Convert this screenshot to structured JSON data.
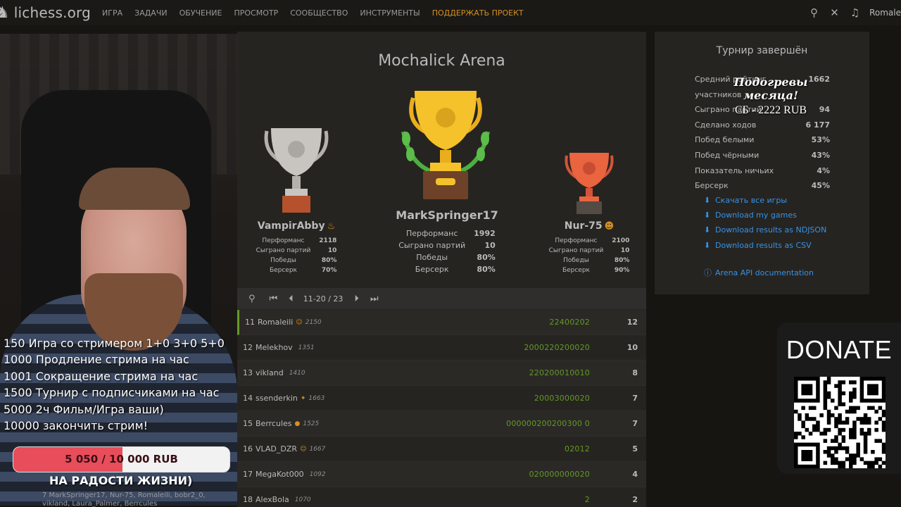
{
  "nav": {
    "brand": "lichess.org",
    "items": [
      "ИГРА",
      "ЗАДАЧИ",
      "ОБУЧЕНИЕ",
      "ПРОСМОТР",
      "СООБЩЕСТВО",
      "ИНСТРУМЕНТЫ"
    ],
    "donate": "ПОДДЕРЖАТЬ ПРОЕКТ",
    "user": "Romale"
  },
  "stream": {
    "commands": [
      "150 Игра со стримером 1+0 3+0 5+0",
      "1000 Продление стрима на час",
      "1001  Сокращение стрима на час",
      "1500 Турнир с подписчиками на час",
      "5000 2ч Фильм/Игра ваши)",
      "10000 закончить стрим!"
    ],
    "progress_text": "5 050 / 10 000 RUB",
    "progress_fraction": 0.505,
    "goal_name": "НА РАДОСТИ ЖИЗНИ)",
    "players_line": "7 MarkSpringer17, Nur-75, Romaleili, bobr2_0, vikland, Laura_Palmer, Berrcules"
  },
  "arena": {
    "title": "Mochalick Arena",
    "podium": {
      "first": {
        "name": "MarkSpringer17",
        "stats": [
          [
            "Перформанс",
            "1992"
          ],
          [
            "Сыграно партий",
            "10"
          ],
          [
            "Победы",
            "80%"
          ],
          [
            "Берсерк",
            "80%"
          ]
        ]
      },
      "second": {
        "name": "VampirAbby",
        "stats": [
          [
            "Перформанс",
            "2118"
          ],
          [
            "Сыграно партий",
            "10"
          ],
          [
            "Победы",
            "80%"
          ],
          [
            "Берсерк",
            "70%"
          ]
        ]
      },
      "third": {
        "name": "Nur-75",
        "stats": [
          [
            "Перформанс",
            "2100"
          ],
          [
            "Сыграно партий",
            "10"
          ],
          [
            "Победы",
            "80%"
          ],
          [
            "Берсерк",
            "90%"
          ]
        ]
      }
    },
    "pagination": "11-20 / 23",
    "standings": [
      {
        "rank": "11",
        "name": "Romaleili",
        "flair": "☺",
        "rating": "2150",
        "scores": "22400202",
        "total": "12"
      },
      {
        "rank": "12",
        "name": "Melekhov",
        "flair": "",
        "rating": "1351",
        "scores": "2000220200020",
        "total": "10"
      },
      {
        "rank": "13",
        "name": "vikland",
        "flair": "",
        "rating": "1410",
        "scores": "220200010010",
        "total": "8"
      },
      {
        "rank": "14",
        "name": "ssenderkin",
        "flair": "✦",
        "rating": "1663",
        "scores": "20003000020",
        "total": "7"
      },
      {
        "rank": "15",
        "name": "Berrcules",
        "flair": "●",
        "rating": "1525",
        "scores": "000000200200300 0",
        "total": "7"
      },
      {
        "rank": "16",
        "name": "VLAD_DZR",
        "flair": "☺",
        "rating": "1667",
        "scores": "02012",
        "total": "5"
      },
      {
        "rank": "17",
        "name": "MegaKot000",
        "flair": "",
        "rating": "1092",
        "scores": "020000000020",
        "total": "4"
      },
      {
        "rank": "18",
        "name": "AlexBola",
        "flair": "",
        "rating": "1070",
        "scores": "2",
        "total": "2"
      }
    ]
  },
  "stats": {
    "title": "Турнир завершён",
    "lines": [
      [
        "Средний рейтинг участников",
        "1662"
      ],
      [
        "Сыграно партий",
        "94"
      ],
      [
        "Сделано ходов",
        "6 177"
      ],
      [
        "Побед белыми",
        "53%"
      ],
      [
        "Побед чёрными",
        "43%"
      ],
      [
        "Показатель ничьих",
        "4%"
      ],
      [
        "Берсерк",
        "45%"
      ]
    ],
    "links": [
      "Скачать все игры",
      "Download my games",
      "Download results as NDJSON",
      "Download results as CSV"
    ],
    "api": "Arena API documentation"
  },
  "promo": {
    "line1": "Подогревы месяца!",
    "line2": "СБ - 2222 RUB"
  },
  "donate": {
    "label": "DONATE"
  }
}
